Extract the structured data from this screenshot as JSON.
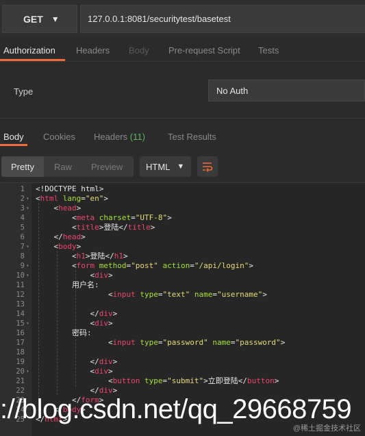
{
  "request": {
    "method": "GET",
    "url": "127.0.0.1:8081/securitytest/basetest"
  },
  "request_tabs": [
    "Authorization",
    "Headers",
    "Body",
    "Pre-request Script",
    "Tests"
  ],
  "auth": {
    "type_label": "Type",
    "type_value": "No Auth"
  },
  "response_tabs": {
    "body": "Body",
    "cookies": "Cookies",
    "headers": "Headers",
    "headers_count": "(11)",
    "test_results": "Test Results"
  },
  "view_modes": [
    "Pretty",
    "Raw",
    "Preview"
  ],
  "format": "HTML",
  "code_lines": [
    {
      "n": "1",
      "fold": "",
      "html": "&lt;!DOCTYPE html&gt;"
    },
    {
      "n": "2",
      "fold": "▾",
      "html": "&lt;<span class='t'>html</span> <span class='a'>lang</span>=<span class='s'>\"en\"</span>&gt;"
    },
    {
      "n": "3",
      "fold": "▾",
      "html": "    &lt;<span class='t'>head</span>&gt;"
    },
    {
      "n": "4",
      "fold": "",
      "html": "        &lt;<span class='t'>meta</span> <span class='a'>charset</span>=<span class='s'>\"UTF-8\"</span>&gt;"
    },
    {
      "n": "5",
      "fold": "",
      "html": "        &lt;<span class='t'>title</span>&gt;登陆&lt;/<span class='t'>title</span>&gt;"
    },
    {
      "n": "6",
      "fold": "",
      "html": "    &lt;/<span class='t'>head</span>&gt;"
    },
    {
      "n": "7",
      "fold": "▾",
      "html": "    &lt;<span class='t'>body</span>&gt;"
    },
    {
      "n": "8",
      "fold": "",
      "html": "        &lt;<span class='t'>h1</span>&gt;登陆&lt;/<span class='t'>h1</span>&gt;"
    },
    {
      "n": "9",
      "fold": "▾",
      "html": "        &lt;<span class='t'>form</span> <span class='a'>method</span>=<span class='s'>\"post\"</span> <span class='a'>action</span>=<span class='s'>\"/api/login\"</span>&gt;"
    },
    {
      "n": "10",
      "fold": "▾",
      "html": "            &lt;<span class='t'>div</span>&gt;"
    },
    {
      "n": "11",
      "fold": "",
      "html": "        用户名:"
    },
    {
      "n": "12",
      "fold": "",
      "html": "                &lt;<span class='t'>input</span> <span class='a'>type</span>=<span class='s'>\"text\"</span> <span class='a'>name</span>=<span class='s'>\"username\"</span>&gt;"
    },
    {
      "n": "13",
      "fold": "",
      "html": ""
    },
    {
      "n": "14",
      "fold": "",
      "html": "            &lt;/<span class='t'>div</span>&gt;"
    },
    {
      "n": "15",
      "fold": "▾",
      "html": "            &lt;<span class='t'>div</span>&gt;"
    },
    {
      "n": "16",
      "fold": "",
      "html": "        密码:"
    },
    {
      "n": "17",
      "fold": "",
      "html": "                &lt;<span class='t'>input</span> <span class='a'>type</span>=<span class='s'>\"password\"</span> <span class='a'>name</span>=<span class='s'>\"password\"</span>&gt;"
    },
    {
      "n": "18",
      "fold": "",
      "html": ""
    },
    {
      "n": "19",
      "fold": "",
      "html": "            &lt;/<span class='t'>div</span>&gt;"
    },
    {
      "n": "20",
      "fold": "▾",
      "html": "            &lt;<span class='t'>div</span>&gt;"
    },
    {
      "n": "21",
      "fold": "",
      "html": "                &lt;<span class='t'>button</span> <span class='a'>type</span>=<span class='s'>\"submit\"</span>&gt;立即登陆&lt;/<span class='t'>button</span>&gt;"
    },
    {
      "n": "22",
      "fold": "",
      "html": "            &lt;/<span class='t'>div</span>&gt;"
    },
    {
      "n": "23",
      "fold": "",
      "html": "        &lt;/<span class='t'>form</span>&gt;"
    },
    {
      "n": "24",
      "fold": "",
      "html": "    &lt;/<span class='t'>body</span>&gt;"
    },
    {
      "n": "25",
      "fold": "",
      "html": "&lt;/<span class='t'>html</span>&gt;"
    }
  ],
  "watermark": "://blog.csdn.net/qq_29668759",
  "credit": "@稀土掘金技术社区",
  "colors": {
    "accent": "#f26b3a",
    "tag": "#f2446e",
    "attr": "#a6e22e",
    "string": "#e6db74",
    "count": "#5cb85c"
  }
}
